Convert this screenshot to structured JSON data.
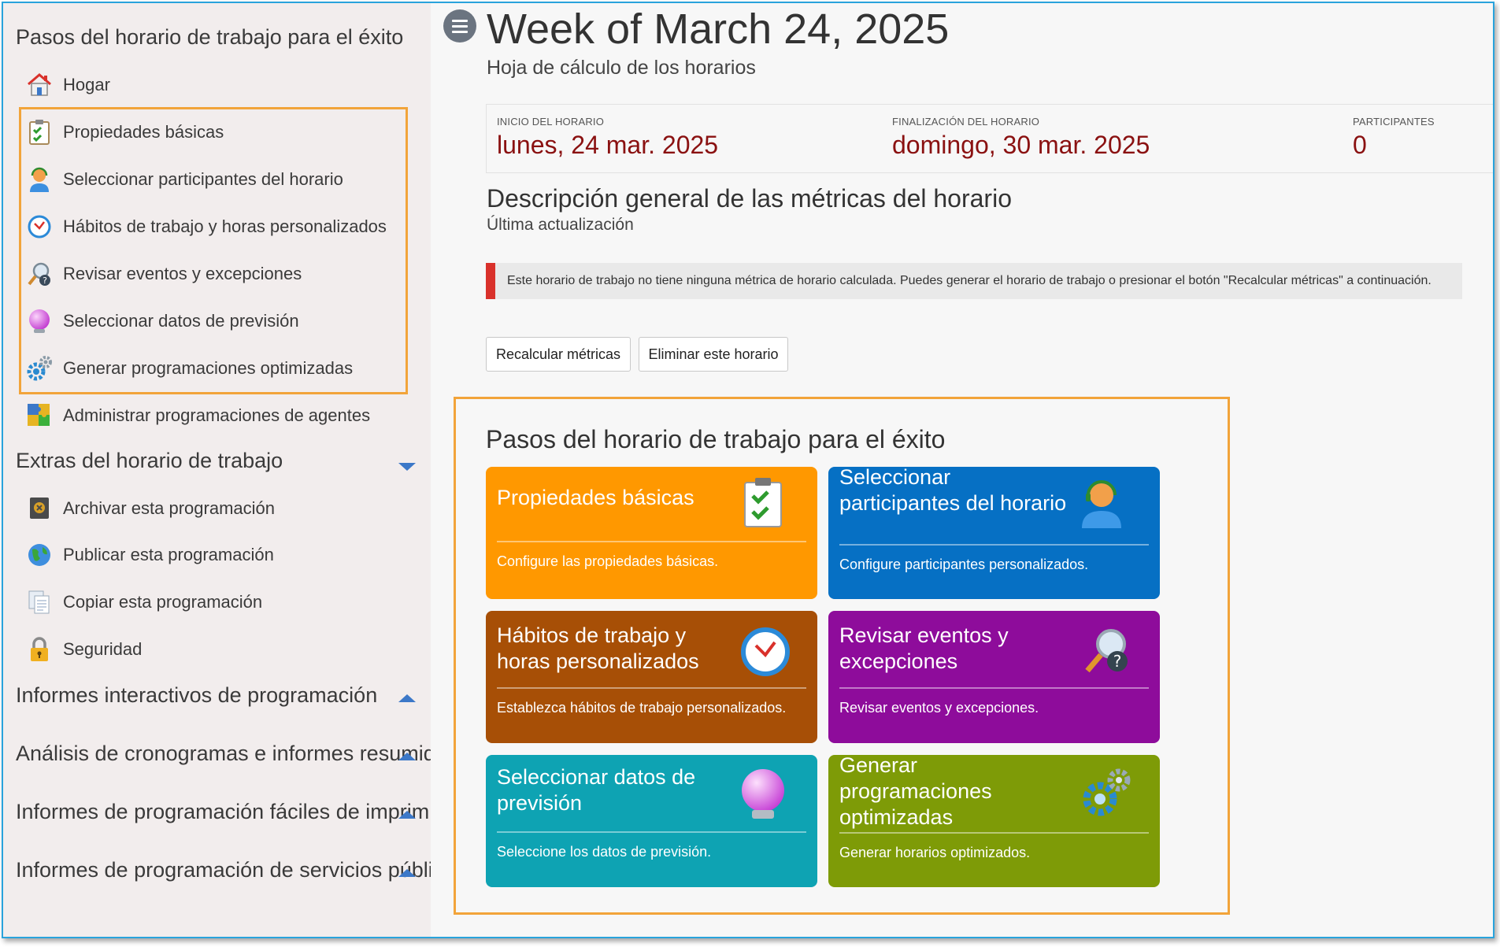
{
  "sidebar": {
    "section_title": "Pasos del horario de trabajo para el éxito",
    "items": [
      {
        "label": "Hogar",
        "icon": "home-icon"
      },
      {
        "label": "Propiedades básicas",
        "icon": "clipboard-check-icon"
      },
      {
        "label": "Seleccionar participantes del horario",
        "icon": "agent-headset-icon"
      },
      {
        "label": "Hábitos de trabajo y horas personalizados",
        "icon": "clock-icon"
      },
      {
        "label": "Revisar eventos y excepciones",
        "icon": "magnifier-question-icon"
      },
      {
        "label": "Seleccionar datos de previsión",
        "icon": "crystal-ball-icon"
      },
      {
        "label": "Generar programaciones optimizadas",
        "icon": "gears-icon"
      },
      {
        "label": "Administrar programaciones de agentes",
        "icon": "puzzle-icon"
      }
    ],
    "extras_title": "Extras del horario de trabajo",
    "extras": [
      {
        "label": "Archivar esta programación",
        "icon": "archive-safe-icon"
      },
      {
        "label": "Publicar esta programación",
        "icon": "globe-icon"
      },
      {
        "label": "Copiar esta programación",
        "icon": "copy-document-icon"
      },
      {
        "label": "Seguridad",
        "icon": "lock-icon"
      }
    ],
    "report_sections": [
      "Informes interactivos de programación",
      "Análisis de cronogramas e informes resumidos",
      "Informes de programación fáciles de imprimir",
      "Informes de programación de servicios públicos"
    ]
  },
  "header": {
    "title": "Week of March 24, 2025",
    "subtitle": "Hoja de cálculo de los horarios"
  },
  "schedule_info": {
    "start_label": "INICIO DEL HORARIO",
    "start_value": "lunes, 24 mar. 2025",
    "end_label": "FINALIZACIÓN DEL HORARIO",
    "end_value": "domingo, 30 mar. 2025",
    "participants_label": "PARTICIPANTES",
    "participants_value": "0"
  },
  "metrics": {
    "title": "Descripción general de las métricas del horario",
    "last_updated": "Última actualización",
    "alert": "Este horario de trabajo no tiene ninguna métrica de horario calculada. Puedes generar el horario de trabajo o presionar el botón \"Recalcular métricas\" a continuación."
  },
  "actions": {
    "recalc": "Recalcular métricas",
    "delete": "Eliminar este horario"
  },
  "steps": {
    "title": "Pasos del horario de trabajo para el éxito",
    "cards": [
      {
        "title": "Propiedades básicas",
        "desc": "Configure las propiedades básicas.",
        "color": "#ff9800",
        "icon": "clipboard-check-icon"
      },
      {
        "title": "Seleccionar participantes del horario",
        "desc": "Configure participantes personalizados.",
        "color": "#0670c4",
        "icon": "agent-headset-icon"
      },
      {
        "title": "Hábitos de trabajo y horas personalizados",
        "desc": "Establezca hábitos de trabajo personalizados.",
        "color": "#a74f06",
        "icon": "clock-icon"
      },
      {
        "title": "Revisar eventos y excepciones",
        "desc": "Revisar eventos y excepciones.",
        "color": "#8e0c9b",
        "icon": "magnifier-question-icon"
      },
      {
        "title": "Seleccionar datos de previsión",
        "desc": "Seleccione los datos de previsión.",
        "color": "#0ea3b3",
        "icon": "crystal-ball-icon"
      },
      {
        "title": "Generar programaciones optimizadas",
        "desc": "Generar horarios optimizados.",
        "color": "#7e9b07",
        "icon": "gears-icon"
      }
    ]
  },
  "colors": {
    "accent_orange": "#f2a43a",
    "value_red": "#8a1111",
    "alert_red": "#d9312b",
    "link_blue": "#3c78c8"
  }
}
